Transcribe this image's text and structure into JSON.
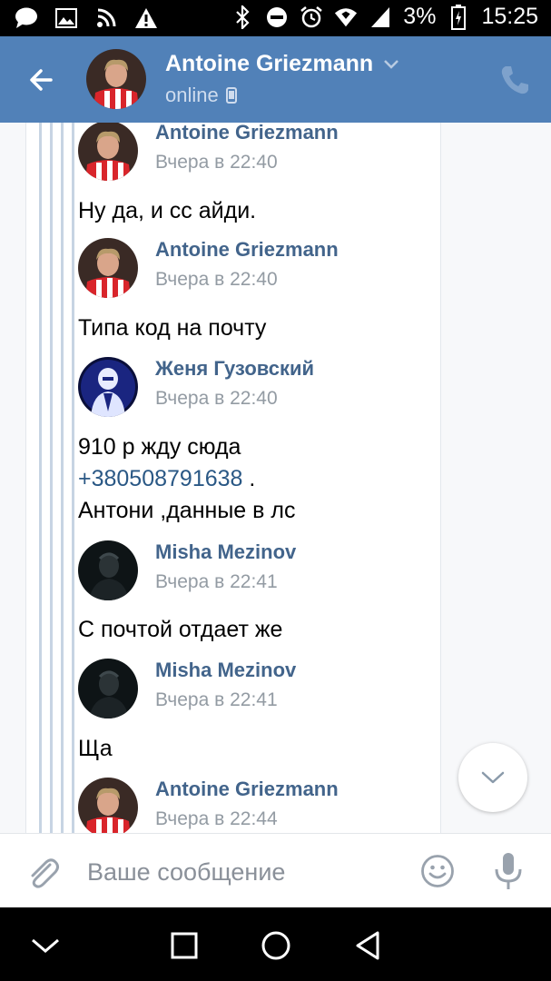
{
  "status_bar": {
    "battery": "3%",
    "time": "15:25"
  },
  "header": {
    "name": "Antoine Griezmann",
    "status": "online"
  },
  "messages": [
    {
      "author": "Antoine Griezmann",
      "time": "Вчера в 22:40",
      "avatar": "griezmann-avatar",
      "lines": [
        "Ну да, и сс айди."
      ]
    },
    {
      "author": "Antoine Griezmann",
      "time": "Вчера в 22:40",
      "avatar": "griezmann-avatar",
      "lines": [
        "Типа код на почту"
      ]
    },
    {
      "author": "Женя Гузовский",
      "time": "Вчера в 22:40",
      "avatar": "guzovsky-avatar",
      "lines": [
        "910 р жду сюда",
        "+380508791638",
        ".",
        "Антони ,данные в лс"
      ]
    },
    {
      "author": "Misha Mezinov",
      "time": "Вчера в 22:41",
      "avatar": "mezinov-avatar",
      "lines": [
        "С почтой отдает же"
      ]
    },
    {
      "author": "Misha Mezinov",
      "time": "Вчера в 22:41",
      "avatar": "mezinov-avatar",
      "lines": [
        "Ща"
      ]
    },
    {
      "author": "Antoine Griezmann",
      "time": "Вчера в 22:44",
      "avatar": "griezmann-avatar",
      "lines": []
    }
  ],
  "composer": {
    "placeholder": "Ваше сообщение"
  },
  "colors": {
    "header_bg": "#5181b8",
    "author_name": "#42648b",
    "link": "#2a5885",
    "timestamp": "#939ba3"
  },
  "icons": {
    "status_bar": [
      "chat-icon",
      "image-icon",
      "rss-icon",
      "warning-icon",
      "bluetooth-icon",
      "do-not-disturb-icon",
      "alarm-icon",
      "wifi-icon",
      "signal-icon",
      "battery-icon"
    ],
    "header": [
      "back-arrow-icon",
      "chevron-down-icon",
      "phone-icon",
      "mobile-icon"
    ],
    "composer": [
      "paperclip-icon",
      "emoji-icon",
      "microphone-icon"
    ],
    "nav": [
      "nav-down-icon",
      "nav-recents-icon",
      "nav-home-icon",
      "nav-back-icon"
    ]
  }
}
